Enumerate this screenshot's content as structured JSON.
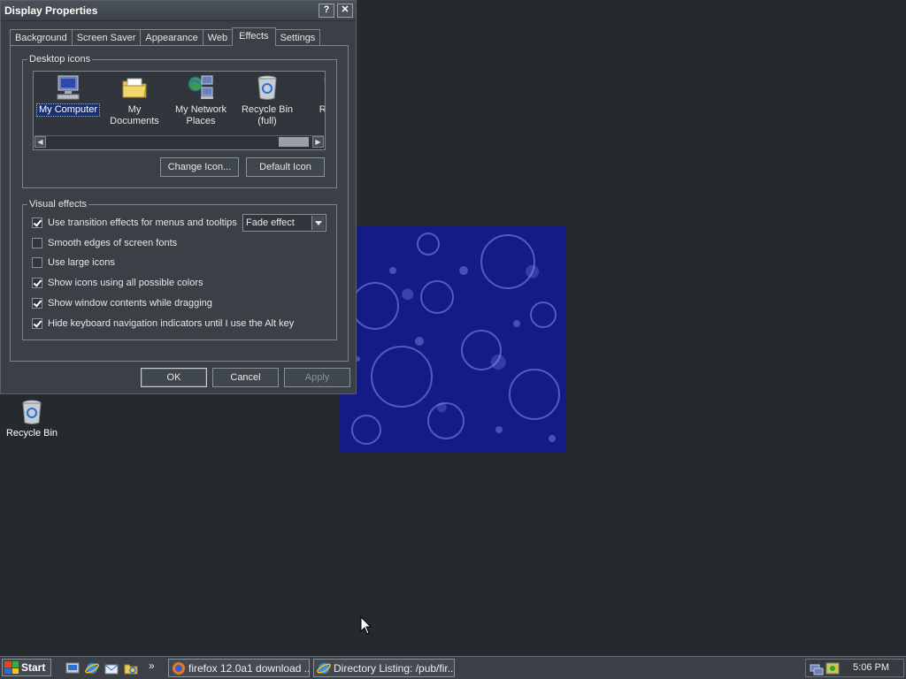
{
  "window": {
    "title": "Display Properties",
    "help_btn": "?",
    "close_btn": "✕"
  },
  "tabs": [
    "Background",
    "Screen Saver",
    "Appearance",
    "Web",
    "Effects",
    "Settings"
  ],
  "active_tab": "Effects",
  "desktop_icons_group": {
    "legend": "Desktop icons",
    "items": [
      {
        "label": "My Computer",
        "icon": "computer-icon",
        "selected": true
      },
      {
        "label": "My Documents",
        "icon": "folder-icon",
        "selected": false
      },
      {
        "label": "My Network Places",
        "icon": "network-icon",
        "selected": false
      },
      {
        "label": "Recycle Bin (full)",
        "icon": "recycle-bin-icon",
        "selected": false
      },
      {
        "label": "Rec (e",
        "icon": "recycle-bin-icon",
        "selected": false
      }
    ],
    "change_icon_button": "Change Icon...",
    "default_icon_button": "Default Icon"
  },
  "visual_effects_group": {
    "legend": "Visual effects",
    "options": [
      {
        "label": "Use transition effects for menus and tooltips",
        "checked": true
      },
      {
        "label": "Smooth edges of screen fonts",
        "checked": false
      },
      {
        "label": "Use large icons",
        "checked": false
      },
      {
        "label": "Show icons using all possible colors",
        "checked": true
      },
      {
        "label": "Show window contents while dragging",
        "checked": true
      },
      {
        "label": "Hide keyboard navigation indicators until I use the Alt key",
        "checked": true
      }
    ],
    "transition_select_value": "Fade effect"
  },
  "dialog_buttons": {
    "ok": "OK",
    "cancel": "Cancel",
    "apply": "Apply"
  },
  "desktop": {
    "recycle_bin_label": "Recycle Bin"
  },
  "taskbar": {
    "start_label": "Start",
    "chevron": "»",
    "tasks": [
      {
        "label": "firefox 12.0a1 download ...",
        "icon": "firefox-icon"
      },
      {
        "label": "Directory Listing: /pub/fir...",
        "icon": "ie-icon"
      }
    ],
    "clock": "5:06 PM"
  },
  "colors": {
    "desktop_bg": "#252a2e",
    "window_bg": "#3a4046",
    "wallpaper_blue": "#141a86",
    "selection": "#1a2f6e"
  }
}
